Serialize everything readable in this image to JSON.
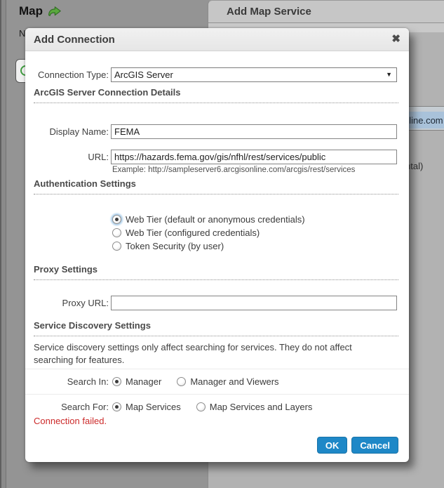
{
  "background": {
    "map_panel": {
      "title": "Map",
      "icon": "green-forward-arrow-icon",
      "partial_label": "N"
    },
    "service_panel": {
      "title": "Add Map Service",
      "url_input_selected_text": "nline.com",
      "partial_text": "ntal)"
    }
  },
  "dialog": {
    "title": "Add Connection",
    "close_glyph": "✖",
    "fields": {
      "connection_type": {
        "label": "Connection Type:",
        "value": "ArcGIS Server",
        "caret": "▼"
      },
      "display_name": {
        "label": "Display Name:",
        "value": "FEMA"
      },
      "url": {
        "label": "URL:",
        "value": "https://hazards.fema.gov/gis/nfhl/rest/services/public",
        "example": "Example: http://sampleserver6.arcgisonline.com/arcgis/rest/services"
      },
      "proxy_url": {
        "label": "Proxy URL:",
        "value": ""
      }
    },
    "section_headers": {
      "connection_details": "ArcGIS Server Connection Details",
      "authentication": "Authentication Settings",
      "proxy": "Proxy Settings",
      "service_discovery": "Service Discovery Settings"
    },
    "auth_options": [
      {
        "label": "Web Tier (default or anonymous credentials)",
        "selected": true
      },
      {
        "label": "Web Tier (configured credentials)",
        "selected": false
      },
      {
        "label": "Token Security (by user)",
        "selected": false
      }
    ],
    "discovery_note": "Service discovery settings only affect searching for services. They do not affect searching for features.",
    "search_in": {
      "label": "Search In:",
      "options": [
        {
          "label": "Manager",
          "selected": true
        },
        {
          "label": "Manager and Viewers",
          "selected": false
        }
      ]
    },
    "search_for": {
      "label": "Search For:",
      "options": [
        {
          "label": "Map Services",
          "selected": true
        },
        {
          "label": "Map Services and Layers",
          "selected": false
        }
      ]
    },
    "error_message": "Connection failed.",
    "buttons": {
      "ok": "OK",
      "cancel": "Cancel"
    }
  },
  "colors": {
    "button_blue": "#1e88c7",
    "error_red": "#cc2a2a",
    "overlay_gray": "#949494",
    "selection_blue": "#a9c2da"
  }
}
